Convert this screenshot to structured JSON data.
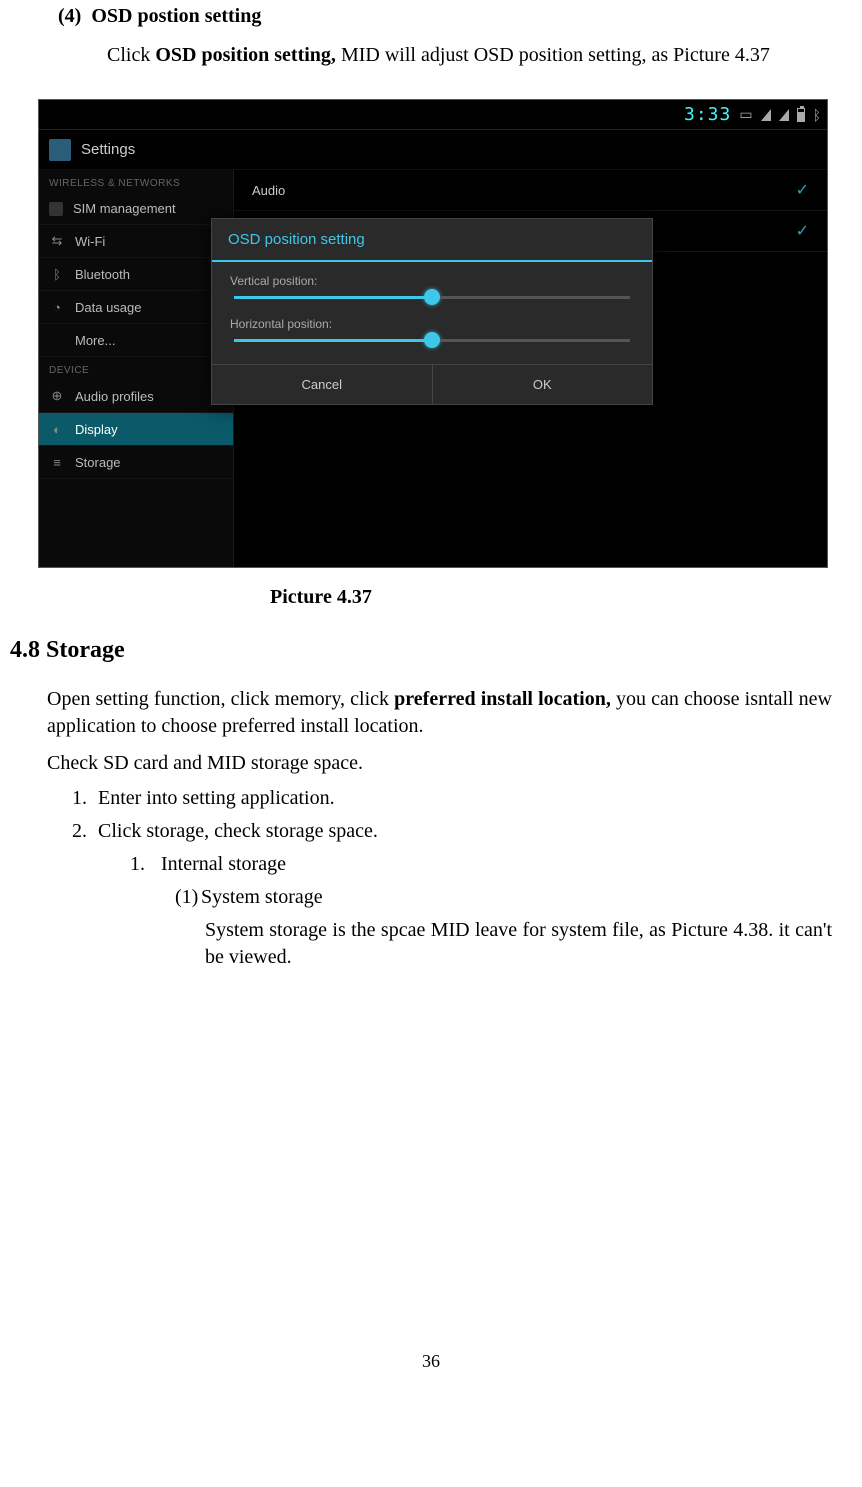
{
  "heading4": {
    "num": "(4)",
    "title": "OSD postion setting"
  },
  "intro_line": {
    "prefix": "Click ",
    "bold": "OSD position setting,",
    "suffix": " MID will adjust OSD position setting, as Picture 4.37"
  },
  "screenshot": {
    "statusbar": {
      "time": "3:33"
    },
    "titlebar": {
      "title": "Settings"
    },
    "sidebar": {
      "group1_head": "WIRELESS & NETWORKS",
      "group1": [
        {
          "label": "SIM management"
        },
        {
          "label": "Wi-Fi"
        },
        {
          "label": "Bluetooth"
        },
        {
          "label": "Data usage"
        },
        {
          "label": "More..."
        }
      ],
      "group2_head": "DEVICE",
      "group2": [
        {
          "label": "Audio profiles"
        },
        {
          "label": "Display"
        },
        {
          "label": "Storage"
        }
      ]
    },
    "main": {
      "rows": [
        {
          "label": "Audio",
          "checked": true
        },
        {
          "label": "",
          "checked": true
        }
      ]
    },
    "dialog": {
      "title": "OSD position setting",
      "slider1_label": "Vertical position:",
      "slider2_label": "Horizontal position:",
      "cancel": "Cancel",
      "ok": "OK"
    }
  },
  "caption": "Picture 4.37",
  "section48": {
    "heading": "4.8 Storage",
    "p1_prefix": "Open setting function, click memory, click ",
    "p1_bold": "preferred install location,",
    "p1_suffix": " you can choose isntall new application to choose preferred install location.",
    "p2": "Check SD card and MID storage space.",
    "steps": [
      {
        "n": "1.",
        "t": "Enter into setting application."
      },
      {
        "n": "2.",
        "t": "Click storage, check storage space."
      }
    ],
    "sub1": {
      "n": "1.",
      "t": "Internal storage"
    },
    "sub2": {
      "n": "(1)",
      "t": "System storage"
    },
    "sub2_text": "System storage is the spcae MID leave for system file, as Picture 4.38. it can't be viewed."
  },
  "page_num": "36"
}
